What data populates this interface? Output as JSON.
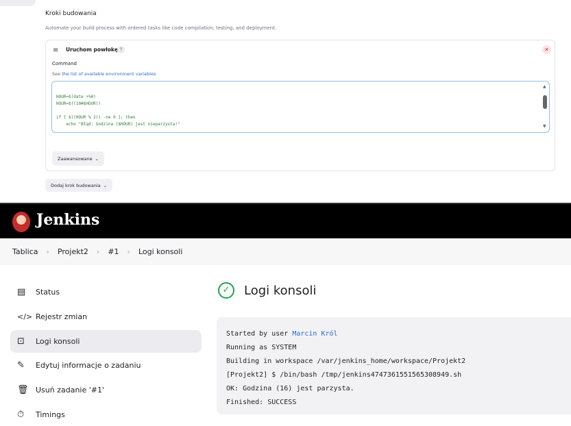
{
  "build_steps": {
    "title": "Kroki budowania",
    "description": "Automate your build process with ordered tasks like code compilation, testing, and deployment.",
    "step": {
      "title": "Uruchom powłokę",
      "help": "?",
      "command_label": "Command",
      "link_prefix": "See ",
      "link_text": "the list of available environment variables",
      "command": "\nHOUR=$(date +%H)\nHOUR=$((10#$HOUR))\n\nif [ $((HOUR % 2)) -ne 0 ]; then\n    echo \"Błąd: Godzina ($HOUR) jest nieparzysta!\"",
      "advanced_label": "Zaawansowane"
    },
    "add_step_label": "Dodaj krok budowania"
  },
  "jenkins": {
    "brand": "Jenkins",
    "breadcrumbs": [
      "Tablica",
      "Projekt2",
      "#1",
      "Logi konsoli"
    ],
    "sidebar": [
      {
        "icon": "document-icon",
        "glyph": "▤",
        "label": "Status"
      },
      {
        "icon": "code-icon",
        "glyph": "</>",
        "label": "Rejestr zmian"
      },
      {
        "icon": "terminal-icon",
        "glyph": "⊡",
        "label": "Logi konsoli"
      },
      {
        "icon": "edit-icon",
        "glyph": "✎",
        "label": "Edytuj informacje o zadaniu"
      },
      {
        "icon": "trash-icon",
        "glyph": "🗑",
        "label": "Usuń zadanie '#1'"
      },
      {
        "icon": "timer-icon",
        "glyph": "⏱",
        "label": "Timings"
      }
    ],
    "page_title": "Logi konsoli",
    "console": {
      "started_prefix": "Started by user ",
      "user": "Marcin Król",
      "lines": [
        "Running as SYSTEM",
        "Building in workspace /var/jenkins_home/workspace/Projekt2",
        "[Projekt2] $ /bin/bash /tmp/jenkins4747361551565308949.sh",
        "OK: Godzina (16) jest parzysta.",
        "Finished: SUCCESS"
      ]
    }
  }
}
